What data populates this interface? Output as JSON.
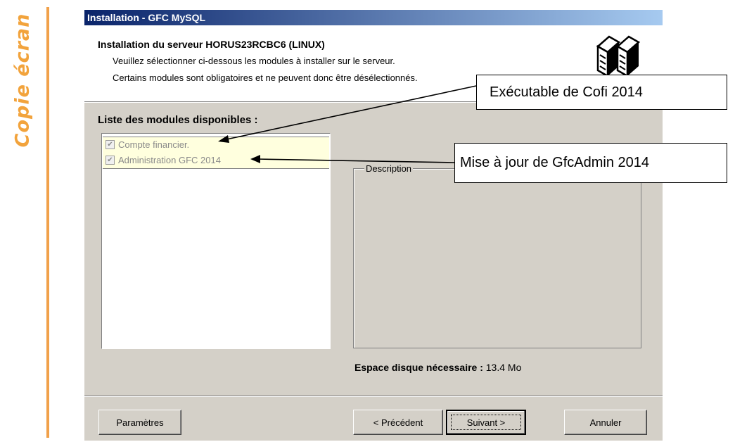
{
  "side_label": "Copie écran",
  "dialog": {
    "title": "Installation - GFC MySQL",
    "header": {
      "title": "Installation du serveur HORUS23RCBC6 (LINUX)",
      "line1": "Veuillez sélectionner ci-dessous les modules à installer sur le serveur.",
      "line2": "Certains modules sont obligatoires et ne peuvent donc être désélectionnés.",
      "logo_icon": "server-icon"
    },
    "modules": {
      "caption": "Liste des modules disponibles :",
      "items": [
        {
          "label": "Compte financier.",
          "checked": true,
          "disabled": true
        },
        {
          "label": "Administration GFC 2014",
          "checked": true,
          "disabled": true
        }
      ]
    },
    "description": {
      "label": "Description",
      "text": ""
    },
    "disk": {
      "label": "Espace disque nécessaire :",
      "value": "13.4 Mo"
    },
    "buttons": {
      "params": "Paramètres",
      "prev": "< Précédent",
      "next": "Suivant >",
      "cancel": "Annuler"
    }
  },
  "callouts": {
    "cofi": "Exécutable de Cofi 2014",
    "gfcadmin": "Mise à jour de GfcAdmin 2014"
  },
  "colors": {
    "accent": "#f2a33c",
    "title_bar_start": "#0a246a",
    "title_bar_end": "#a6caf0",
    "dialog_face": "#d4d0c8",
    "selection_bg": "#ffffde"
  }
}
